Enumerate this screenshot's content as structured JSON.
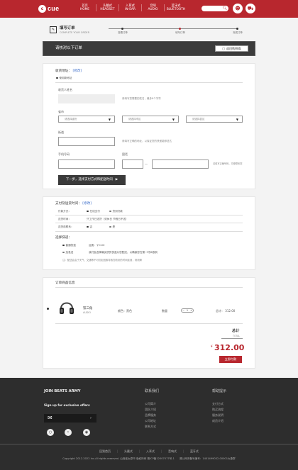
{
  "header": {
    "logo_text": "cue",
    "nav": [
      {
        "cn": "首页",
        "en": "HOME"
      },
      {
        "cn": "头戴式",
        "en": "HEADSET"
      },
      {
        "cn": "入耳式",
        "en": "IN-EAR"
      },
      {
        "cn": "音响",
        "en": "AUDIO"
      },
      {
        "cn": "蓝牙式",
        "en": "BLUETOOTH"
      }
    ],
    "search_icon": "search-icon",
    "user_icon": "user-icon",
    "cart_icon": "cart-icon",
    "brand_color": "#b8272e"
  },
  "steps": {
    "title": "填写订单",
    "subtitle": "COMPLETE YOUR ORDER",
    "items": [
      "查看订单",
      "填写订单",
      "完成订单"
    ],
    "current": 2
  },
  "banner": {
    "title": "请核对以下订单",
    "back_button": "返回购物车"
  },
  "address": {
    "title": "收货地址：",
    "edit_link": "[修改]",
    "default_label": "使用新地址",
    "name_label": "收货人姓名",
    "name_hint": "请填写您需要的姓名，最多8个字符",
    "region_label": "省市",
    "province_placeholder": "请选择省份",
    "city_placeholder": "请选择市区",
    "district_placeholder": "请选择县区",
    "street_label": "街道",
    "street_hint": "请填写正确的地址，以保证您的快递能够送达",
    "phone_label": "手机号码",
    "tel_label": "固话",
    "phone_hint": "请填写正确号码，方便联系您",
    "next_button": "下一步，选择支付方式和配送时间"
  },
  "payment": {
    "title": "支付及送货时间：",
    "edit_link": "[修改]",
    "rows": [
      {
        "label": "付款方式：",
        "opt1": "在线支付",
        "opt2": "货到付款"
      },
      {
        "label": "送货时间：",
        "opt1": "只工作日送货（双休日 节假日不送）",
        "opt2": ""
      },
      {
        "label": "送货前联系：",
        "opt1": "否",
        "opt2": "是"
      }
    ],
    "express_title": "选择快递：",
    "express": [
      {
        "name": "普通快递",
        "desc": "运费：￥0.00"
      },
      {
        "name": "加急送",
        "desc": "我们会选择最优质的快递为您配送，以确保您在第一时间收到"
      }
    ],
    "note": "注：配送会由于天气、交通等不可抗拒因素导致您收到的时间延误，请谅解"
  },
  "products": {
    "title": "订单商品信息",
    "items": [
      {
        "name": "铁三角",
        "sub": "AUDIO",
        "color_label": "颜色：",
        "color": "黑色",
        "qty_label": "数量",
        "qty": "1",
        "total_label": "总计：",
        "total": "312.00"
      }
    ],
    "sum_label": "总计",
    "sum_en": "TOTAL",
    "currency": "¥",
    "sum_value": "312.00",
    "pay_button": "立即付款"
  },
  "footer": {
    "join_title": "JOIN BEATS ARMY",
    "signup": "Sign up for exclusive offers",
    "mail_icon": "mail-icon",
    "col1_title": "联系我们",
    "col1": [
      "公司简介",
      "团队介绍",
      "品牌服务",
      "公司地址",
      "联系方式"
    ],
    "col2_title": "帮助提示",
    "col2": [
      "支付方式",
      "购买流程",
      "服务说明",
      "成员介绍"
    ],
    "social": [
      "wechat-icon",
      "weibo-icon",
      "qq-icon"
    ],
    "bottom_links": [
      "回到首页",
      "头戴式",
      "入耳式",
      "音响式",
      "蓝牙式"
    ],
    "copyright": "Copyright 2012-2022 Inc.All rights reserved. 山西省太原市 版权所有 晋ICP备12007077号-1　　晋公网安备号编号：1401499032-00001大象群"
  }
}
